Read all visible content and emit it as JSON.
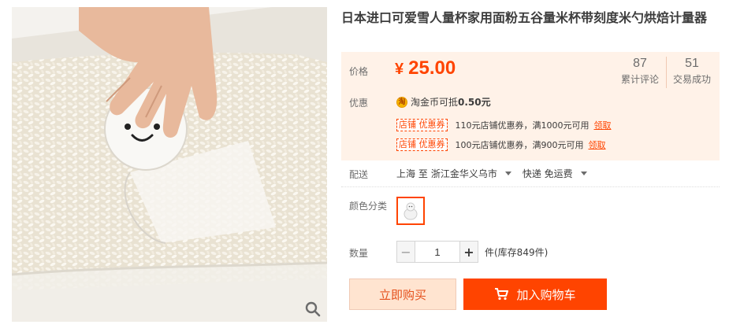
{
  "product": {
    "title": "日本进口可爱雪人量杯家用面粉五谷量米杯带刻度米勺烘焙计量器"
  },
  "price_panel": {
    "price_label": "价格",
    "currency": "¥",
    "price": "25.00",
    "reviews_count": "87",
    "reviews_label": "累计评论",
    "transactions_count": "51",
    "transactions_label": "交易成功",
    "promo_label": "优惠",
    "coin_icon": "淘",
    "coin_text": "淘金币可抵",
    "coin_amount": "0.50元",
    "coupons": [
      {
        "tag": "店铺 优惠券",
        "desc": "110元店铺优惠券，满1000元可用",
        "action": "领取"
      },
      {
        "tag": "店铺 优惠券",
        "desc": "100元店铺优惠券，满900元可用",
        "action": "领取"
      }
    ]
  },
  "shipping": {
    "label": "配送",
    "from": "上海 至",
    "to": "浙江金华义乌市",
    "method": "快递 免运费"
  },
  "color": {
    "label": "颜色分类"
  },
  "quantity": {
    "label": "数量",
    "value": "1",
    "minus": "−",
    "plus": "+",
    "stock_text": "件(库存849件)"
  },
  "actions": {
    "buy_now": "立即购买",
    "add_to_cart": "加入购物车"
  },
  "colors": {
    "accent": "#ff4400",
    "panel_bg": "#fff2e8"
  }
}
